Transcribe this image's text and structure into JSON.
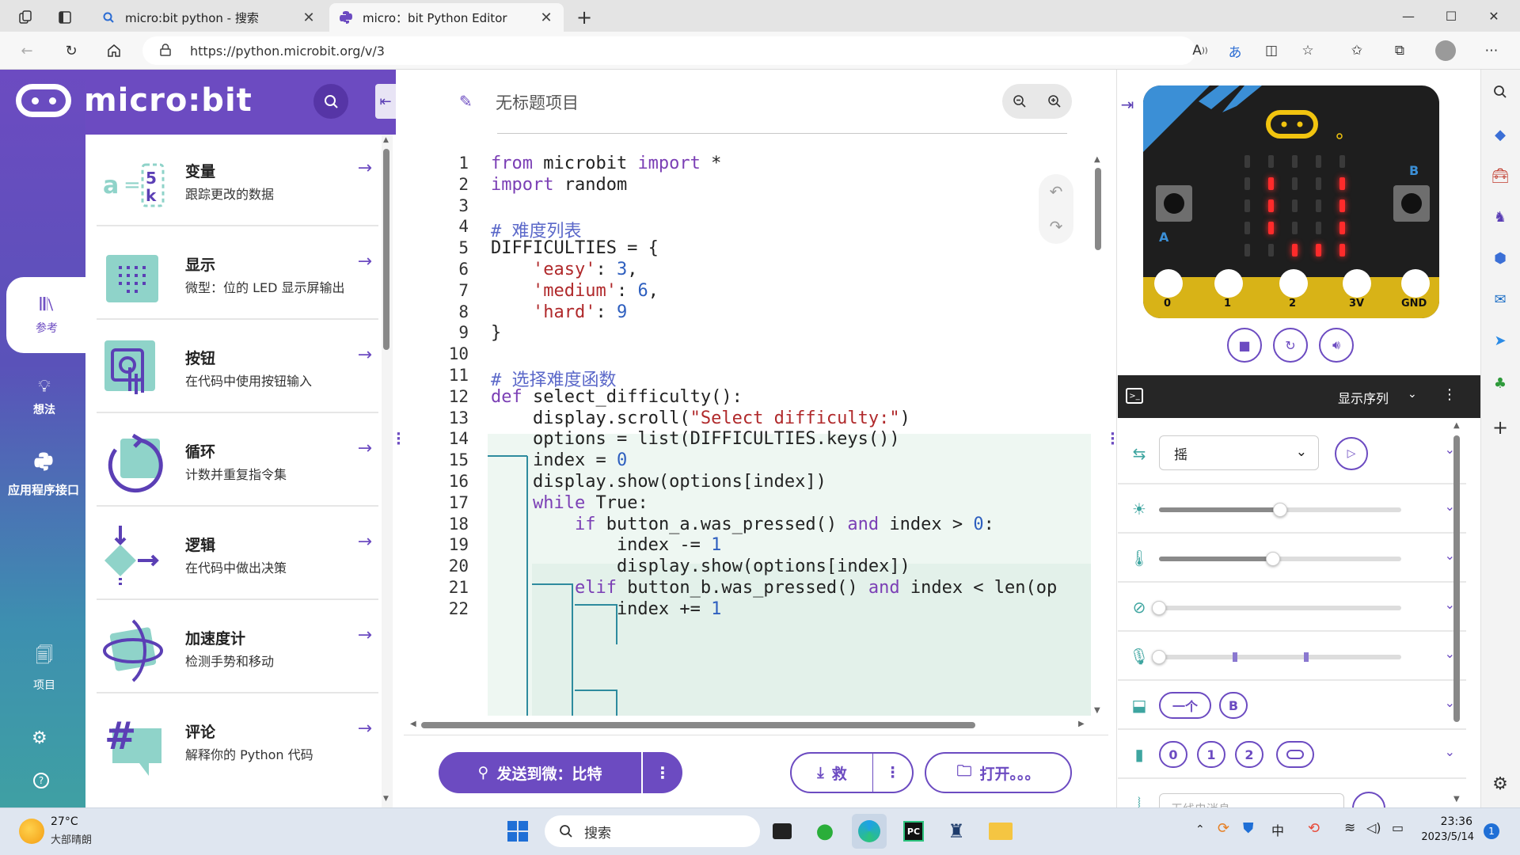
{
  "browser": {
    "tabs": [
      {
        "title": "micro:bit python - 搜索",
        "icon": "search-icon"
      },
      {
        "title": "micro：bit Python Editor",
        "icon": "python-icon"
      }
    ],
    "new_tab": "+",
    "url": "https://python.microbit.org/v/3",
    "window_controls": {
      "minimize": "—",
      "maximize": "☐",
      "close": "✕"
    }
  },
  "app": {
    "logo_text": "micro:bit",
    "rail": [
      {
        "label": "参考",
        "icon": "reference-icon",
        "active": true
      },
      {
        "label": "想法",
        "icon": "lightbulb-icon",
        "active": false
      },
      {
        "label": "应用程序接口",
        "icon": "python-icon",
        "active": false
      },
      {
        "label": "项目",
        "icon": "files-icon",
        "active": false
      }
    ],
    "reference": [
      {
        "title": "变量",
        "desc": "跟踪更改的数据"
      },
      {
        "title": "显示",
        "desc": "微型：位的 LED 显示屏输出"
      },
      {
        "title": "按钮",
        "desc": "在代码中使用按钮输入"
      },
      {
        "title": "循环",
        "desc": "计数并重复指令集"
      },
      {
        "title": "逻辑",
        "desc": "在代码中做出决策"
      },
      {
        "title": "加速度计",
        "desc": "检测手势和移动"
      },
      {
        "title": "评论",
        "desc": "解释你的 Python 代码"
      }
    ]
  },
  "editor": {
    "project_name": "无标题项目",
    "lines": [
      {
        "n": "1",
        "html": "<span class=\"kw\">from</span> microbit <span class=\"kw\">import</span> *"
      },
      {
        "n": "2",
        "html": "<span class=\"kw\">import</span> random"
      },
      {
        "n": "3",
        "html": ""
      },
      {
        "n": "4",
        "html": "<span class=\"cm\"># 难度列表</span>"
      },
      {
        "n": "5",
        "html": "DIFFICULTIES = {"
      },
      {
        "n": "6",
        "html": "    <span class=\"st\">'easy'</span>: <span class=\"nm\">3</span>,"
      },
      {
        "n": "7",
        "html": "    <span class=\"st\">'medium'</span>: <span class=\"nm\">6</span>,"
      },
      {
        "n": "8",
        "html": "    <span class=\"st\">'hard'</span>: <span class=\"nm\">9</span>"
      },
      {
        "n": "9",
        "html": "}"
      },
      {
        "n": "10",
        "html": ""
      },
      {
        "n": "11",
        "html": "<span class=\"cm\"># 选择难度函数</span>"
      },
      {
        "n": "12",
        "html": "<span class=\"kw\">def</span> select_difficulty():"
      },
      {
        "n": "13",
        "html": "    display.scroll(<span class=\"st\">\"Select difficulty:\"</span>)"
      },
      {
        "n": "14",
        "html": "    options = list(DIFFICULTIES.keys())"
      },
      {
        "n": "15",
        "html": "    index = <span class=\"nm\">0</span>"
      },
      {
        "n": "16",
        "html": "    display.show(options[index])"
      },
      {
        "n": "17",
        "html": "    <span class=\"kw\">while</span> True:"
      },
      {
        "n": "18",
        "html": "        <span class=\"kw\">if</span> button_a.was_pressed() <span class=\"kw\">and</span> index &gt; <span class=\"nm\">0</span>:"
      },
      {
        "n": "19",
        "html": "            index -= <span class=\"nm\">1</span>"
      },
      {
        "n": "20",
        "html": "            display.show(options[index])"
      },
      {
        "n": "21",
        "html": "        <span class=\"kw\">elif</span> button_b.was_pressed() <span class=\"kw\">and</span> index &lt; len(op"
      },
      {
        "n": "22",
        "html": "            index += <span class=\"nm\">1</span>"
      }
    ],
    "send_button": "发送到微：比特",
    "save_button": "救",
    "open_button": "打开。。。"
  },
  "simulator": {
    "pins": [
      "0",
      "1",
      "2",
      "3V",
      "GND"
    ],
    "button_a": "A",
    "button_b": "B",
    "series_label": "显示序列",
    "gesture_value": "摇",
    "brightness_pct": 50,
    "temperature_pct": 47,
    "compass_pct": 0,
    "sound_pct": 0,
    "button_pills": [
      "一个",
      "B"
    ],
    "touch_pills": [
      "0",
      "1",
      "2"
    ],
    "radio_placeholder": "无线电消息"
  },
  "taskbar": {
    "weather_temp": "27°C",
    "weather_desc": "大部晴朗",
    "search_label": "搜索",
    "time": "23:36",
    "date": "2023/5/14",
    "notif_count": "1"
  },
  "colors": {
    "accent": "#6c4bc1",
    "teal": "#3ea5a0"
  }
}
